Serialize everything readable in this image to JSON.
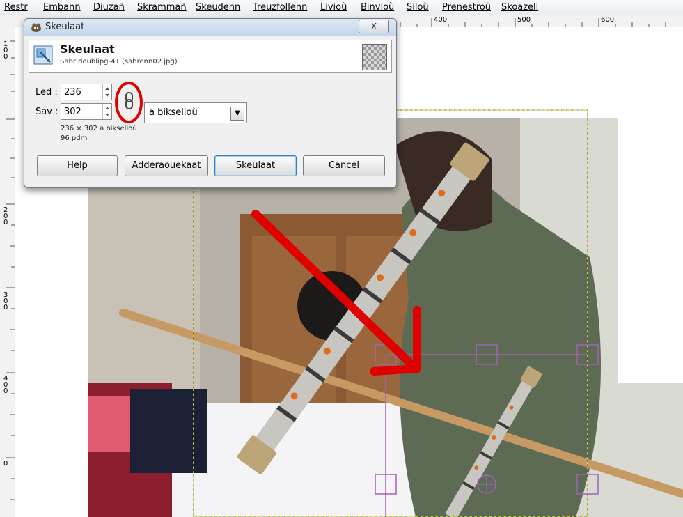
{
  "menubar": {
    "items": [
      "Restr",
      "Embann",
      "Diuzañ",
      "Skrammañ",
      "Skeudenn",
      "Treuzfollenn",
      "Livioù",
      "Binvioù",
      "Siloù",
      "Prenestroù",
      "Skoazell"
    ]
  },
  "rulers": {
    "top": [
      "400",
      "500",
      "600"
    ],
    "left": [
      "100",
      "200",
      "300",
      "400",
      "0"
    ]
  },
  "dialog": {
    "title": "Skeulaat",
    "close_label": "X",
    "header_title": "Skeulaat",
    "header_subtitle": "Sabr doublipg-41 (sabrenn02.jpg)",
    "width_label": "Led :",
    "width_value": "236",
    "height_label": "Sav :",
    "height_value": "302",
    "unit_value": "a bikselioù",
    "size_info": "236 × 302 a bikselioù",
    "dpi_info": "96 pdm",
    "buttons": {
      "help": "Help",
      "reset": "Adderaouekaat",
      "scale": "Skeulaat",
      "cancel": "Cancel"
    }
  },
  "colors": {
    "annotation": "#e00000",
    "selection_handles": "#a064b4",
    "guide_line": "#e8e34a"
  },
  "icons": [
    "scale-image-icon",
    "chain-link-icon",
    "gimp-wilber-icon",
    "close-icon",
    "chevron-down-icon"
  ]
}
